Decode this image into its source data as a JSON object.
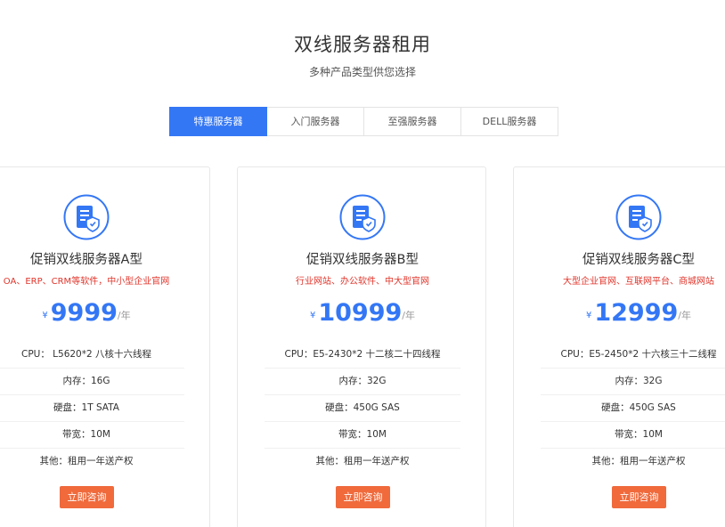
{
  "header": {
    "title": "双线服务器租用",
    "subtitle": "多种产品类型供您选择"
  },
  "tabs": [
    {
      "label": "特惠服务器",
      "active": true
    },
    {
      "label": "入门服务器",
      "active": false
    },
    {
      "label": "至强服务器",
      "active": false
    },
    {
      "label": "DELL服务器",
      "active": false
    }
  ],
  "colors": {
    "accent": "#3477f5",
    "button": "#f06a3c",
    "description": "#e0352b"
  },
  "cards": [
    {
      "icon": "server-shield-icon",
      "title": "促销双线服务器A型",
      "description": "OA、ERP、CRM等软件，中小型企业官网",
      "currency": "¥",
      "price": "9999",
      "unit": "/年",
      "specs": [
        "CPU：  L5620*2 八核十六线程",
        "内存：16G",
        "硬盘：1T SATA",
        "带宽：10M",
        "其他：租用一年送产权"
      ],
      "button": "立即咨询"
    },
    {
      "icon": "server-shield-icon",
      "title": "促销双线服务器B型",
      "description": "行业网站、办公软件、中大型官网",
      "currency": "¥",
      "price": "10999",
      "unit": "/年",
      "specs": [
        "CPU：E5-2430*2 十二核二十四线程",
        "内存：32G",
        "硬盘：450G SAS",
        "带宽：10M",
        "其他：租用一年送产权"
      ],
      "button": "立即咨询"
    },
    {
      "icon": "server-shield-icon",
      "title": "促销双线服务器C型",
      "description": "大型企业官网、互联网平台、商城网站",
      "currency": "¥",
      "price": "12999",
      "unit": "/年",
      "specs": [
        "CPU：E5-2450*2 十六核三十二线程",
        "内存：32G",
        "硬盘：450G SAS",
        "带宽：10M",
        "其他：租用一年送产权"
      ],
      "button": "立即咨询"
    }
  ]
}
